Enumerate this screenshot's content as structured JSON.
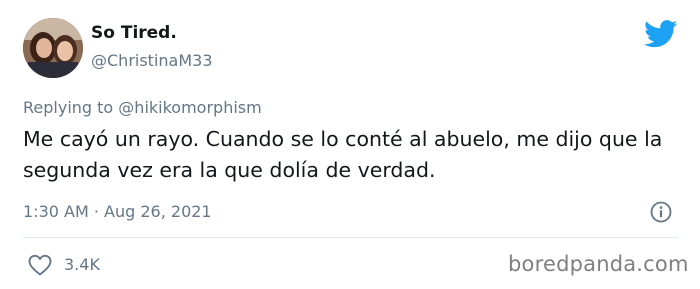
{
  "tweet": {
    "display_name": "So Tired.",
    "handle": "@ChristinaM33",
    "replying_prefix": "Replying to",
    "replying_to": "@hikikomorphism",
    "text": "Me cayó un rayo. Cuando se lo conté al abuelo, me dijo que la segunda vez era la que dolía de verdad.",
    "timestamp": "1:30 AM · Aug 26, 2021",
    "likes": "3.4K"
  },
  "icons": {
    "brand": "twitter-bird-icon",
    "info": "info-icon",
    "like": "heart-icon"
  },
  "colors": {
    "brand_blue": "#1da1f2",
    "secondary_text": "#657786",
    "primary_text": "#14171a"
  },
  "watermark": "boredpanda.com"
}
